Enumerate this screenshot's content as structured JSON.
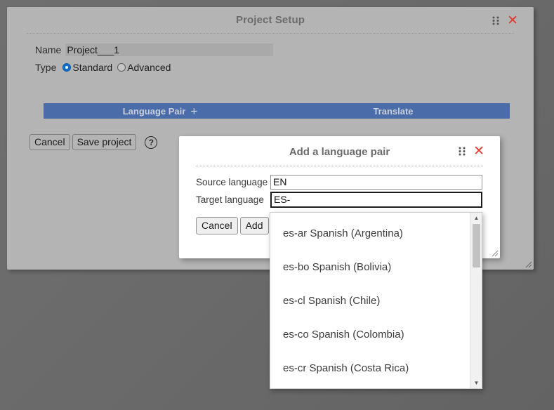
{
  "page": {
    "background_color": "#6d6d6d"
  },
  "project_window": {
    "title": "Project Setup",
    "grip_icon": "drag-grip-icon",
    "close_icon": "close-x-icon",
    "fields": {
      "name_label": "Name",
      "name_value": "Project___1",
      "type_label": "Type",
      "type_options": [
        {
          "label": "Standard",
          "selected": true
        },
        {
          "label": "Advanced",
          "selected": false
        }
      ]
    },
    "table_header": {
      "language_pair_label": "Language Pair",
      "add_icon": "+",
      "translate_label": "Translate",
      "bar_color": "#4a6ca8"
    },
    "buttons": {
      "cancel_label": "Cancel",
      "save_label": "Save project",
      "help_icon": "question-mark-circle-icon",
      "help_glyph": "?"
    }
  },
  "language_modal": {
    "title": "Add a language pair",
    "grip_icon": "drag-grip-icon",
    "close_icon": "close-x-icon",
    "source_label": "Source language",
    "source_value": "EN",
    "target_label": "Target language",
    "target_value": "ES-",
    "cancel_label": "Cancel",
    "add_label": "Add"
  },
  "dropdown": {
    "options": [
      "es-ar Spanish (Argentina)",
      "es-bo Spanish (Bolivia)",
      "es-cl Spanish (Chile)",
      "es-co Spanish (Colombia)",
      "es-cr Spanish (Costa Rica)"
    ],
    "scrollbar": {
      "up_arrow": "▲",
      "down_arrow": "▼",
      "thumb_position": "top"
    }
  }
}
